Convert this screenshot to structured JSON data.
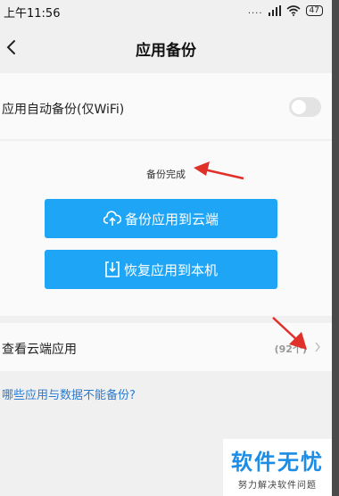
{
  "status_bar": {
    "time": "上午11:56",
    "signal_dots": "....",
    "battery": "47"
  },
  "header": {
    "title": "应用备份"
  },
  "auto_backup": {
    "label": "应用自动备份(仅WiFi)",
    "enabled": false
  },
  "backup_card": {
    "status": "备份完成",
    "backup_button": "备份应用到云端",
    "restore_button": "恢复应用到本机"
  },
  "cloud_apps": {
    "label": "查看云端应用",
    "count": "(92个)"
  },
  "help_link": "哪些应用与数据不能备份?",
  "watermark": {
    "title": "软件无忧",
    "subtitle": "努力解决软件问题"
  },
  "colors": {
    "accent": "#1fa5f5",
    "annotation": "#e0302a",
    "link": "#2a7bd0"
  }
}
